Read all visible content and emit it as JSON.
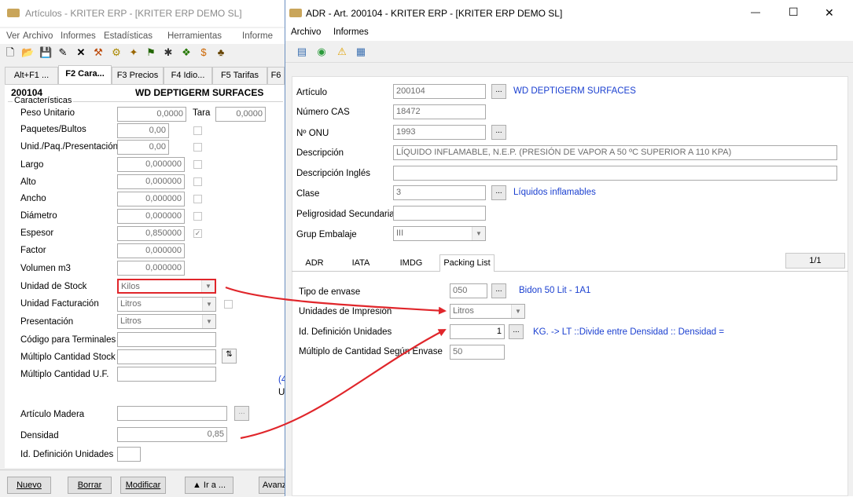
{
  "bg": {
    "title": "Artículos - KRITER ERP - [KRITER ERP DEMO SL]",
    "menu": [
      "Ver",
      "Archivo",
      "Informes",
      "Estadísticas",
      "Herramientas",
      "Informe"
    ],
    "toolbar_icons": [
      "new-icon",
      "open-icon",
      "save-icon",
      "edit-icon",
      "delete-icon",
      "tool-icon",
      "tool2-icon",
      "wand-icon",
      "tool3-icon",
      "tool4-icon",
      "tool5-icon",
      "tool6-icon",
      "tool7-icon"
    ],
    "tabs": [
      "Alt+F1 ...",
      "F2 Cara...",
      "F3 Precios",
      "F4 Idio...",
      "F5 Tarifas",
      "F6"
    ],
    "article_code": "200104",
    "article_name": "WD DEPTIGERM SURFACES",
    "group_label": "Características",
    "fields": {
      "peso_unitario": {
        "label": "Peso Unitario",
        "value": "0,0000"
      },
      "tara": {
        "label": "Tara",
        "value": "0,0000"
      },
      "paquetes": {
        "label": "Paquetes/Bultos",
        "value": "0,00"
      },
      "unid_paq": {
        "label": "Unid./Paq./Presentación",
        "value": "0,00"
      },
      "largo": {
        "label": "Largo",
        "value": "0,000000"
      },
      "alto": {
        "label": "Alto",
        "value": "0,000000"
      },
      "ancho": {
        "label": "Ancho",
        "value": "0,000000"
      },
      "diametro": {
        "label": "Diámetro",
        "value": "0,000000"
      },
      "espesor": {
        "label": "Espesor",
        "value": "0,850000"
      },
      "factor": {
        "label": "Factor",
        "value": "0,000000"
      },
      "volumen": {
        "label": "Volumen m3",
        "value": "0,000000"
      },
      "unidad_stock": {
        "label": "Unidad de Stock",
        "value": "Kilos"
      },
      "unidad_fact": {
        "label": "Unidad Facturación",
        "value": "Litros"
      },
      "presentacion": {
        "label": "Presentación",
        "value": "Litros"
      },
      "codigo_term": {
        "label": "Código para Terminales",
        "value": ""
      },
      "multiplo_stock": {
        "label": "Múltiplo Cantidad Stock",
        "value": ""
      },
      "multiplo_uf": {
        "label": "Múltiplo Cantidad U.F.",
        "value": ""
      },
      "articulo_madera": {
        "label": "Artículo Madera",
        "value": ""
      },
      "densidad": {
        "label": "Densidad",
        "value": "0,85"
      },
      "id_def": {
        "label": "Id. Definición Unidades",
        "value": ""
      }
    },
    "side_clip": [
      "(4",
      "U"
    ],
    "buttons": {
      "nuevo": "Nuevo",
      "borrar": "Borrar",
      "modificar": "Modificar",
      "ira": "▲ Ir a ...",
      "avanz": "Avanz"
    }
  },
  "fg": {
    "title": "ADR - Art. 200104 - KRITER ERP - [KRITER ERP DEMO SL]",
    "window_controls": {
      "min": "—",
      "max": "☐",
      "close": "✕"
    },
    "menu": [
      "Archivo",
      "Informes"
    ],
    "toolbar_icons": [
      "document-icon",
      "globe-icon",
      "warning-icon",
      "grid-icon"
    ],
    "articulo": {
      "label": "Artículo",
      "value": "200104",
      "link": "WD DEPTIGERM SURFACES"
    },
    "cas": {
      "label": "Número CAS",
      "value": "18472"
    },
    "onu": {
      "label": "Nº ONU",
      "value": "1993"
    },
    "descripcion": {
      "label": "Descripción",
      "value": "LÍQUIDO INFLAMABLE, N.E.P. (PRESIÓN DE VAPOR A 50 ºC SUPERIOR A 110 KPA)"
    },
    "descripcion_ingles": {
      "label": "Descripción Inglés",
      "value": ""
    },
    "clase": {
      "label": "Clase",
      "value": "3",
      "link": "Líquidos inflamables"
    },
    "peligrosidad": {
      "label": "Peligrosidad Secundaria",
      "value": ""
    },
    "grup_embalaje": {
      "label": "Grup Embalaje",
      "value": "III"
    },
    "tabs": [
      "ADR",
      "IATA",
      "IMDG",
      "Packing List"
    ],
    "page_indicator": "1/1",
    "packing": {
      "tipo_envase": {
        "label": "Tipo de envase",
        "value": "050",
        "link": "Bidon 50 Lit - 1A1"
      },
      "unidades_impresion": {
        "label": "Unidades de Impresión",
        "value": "Litros"
      },
      "id_def_unidades": {
        "label": "Id. Definición Unidades",
        "value": "1",
        "link": "KG. -> LT ::Divide entre Densidad :: Densidad ="
      },
      "multiplo": {
        "label": "Múltiplo de Cantidad Según Envase",
        "value": "50"
      }
    },
    "ellipsis": "..."
  },
  "colors": {
    "highlight_red": "#e0262b",
    "link_blue": "#1a3fd0"
  }
}
